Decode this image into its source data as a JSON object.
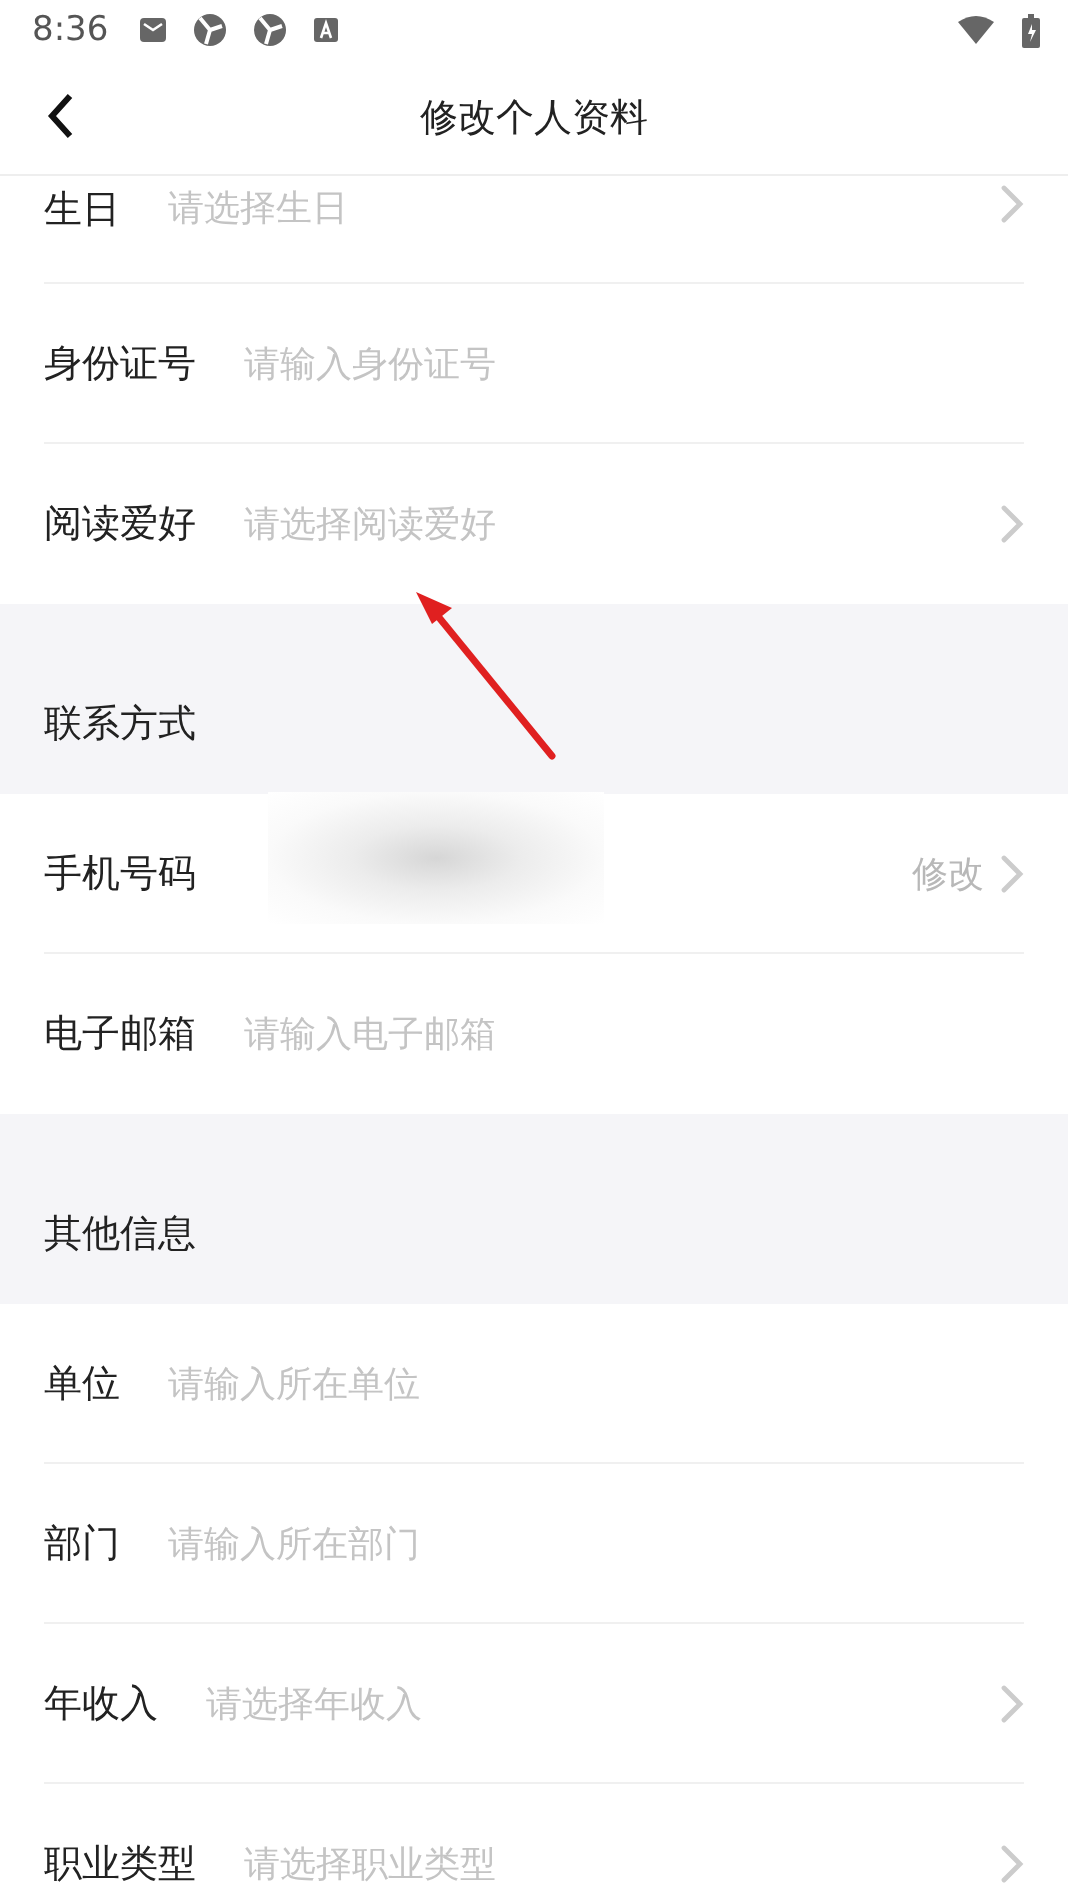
{
  "status_bar": {
    "time": "8:36"
  },
  "header": {
    "title": "修改个人资料"
  },
  "groups": [
    {
      "rows": [
        {
          "kind": "select",
          "label": "生日",
          "placeholder": "请选择生日"
        },
        {
          "kind": "input",
          "label": "身份证号",
          "placeholder": "请输入身份证号"
        },
        {
          "kind": "select",
          "label": "阅读爱好",
          "placeholder": "请选择阅读爱好"
        }
      ]
    },
    {
      "title": "联系方式",
      "rows": [
        {
          "kind": "phone",
          "label": "手机号码",
          "action": "修改"
        },
        {
          "kind": "input",
          "label": "电子邮箱",
          "placeholder": "请输入电子邮箱"
        }
      ]
    },
    {
      "title": "其他信息",
      "rows": [
        {
          "kind": "input",
          "label": "单位",
          "placeholder": "请输入所在单位"
        },
        {
          "kind": "input",
          "label": "部门",
          "placeholder": "请输入所在部门"
        },
        {
          "kind": "select",
          "label": "年收入",
          "placeholder": "请选择年收入"
        },
        {
          "kind": "select",
          "label": "职业类型",
          "placeholder": "请选择职业类型"
        }
      ]
    }
  ]
}
